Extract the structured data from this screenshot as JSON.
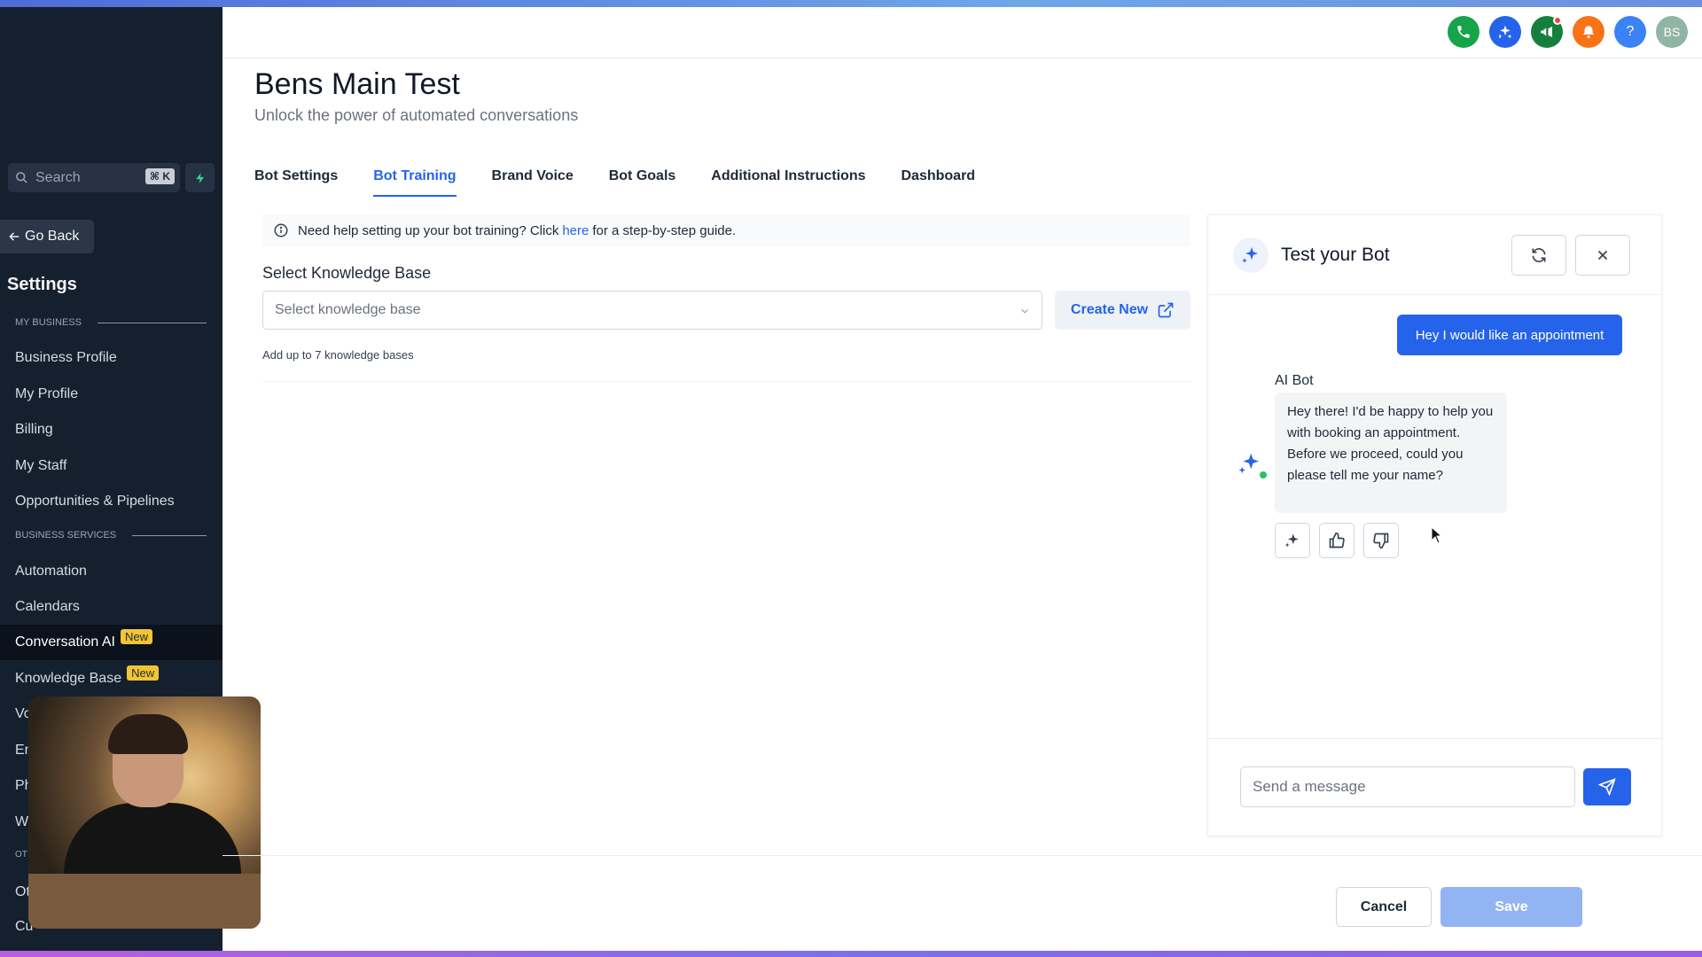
{
  "header": {
    "icons": [
      {
        "name": "phone-icon",
        "color": "#16a34a"
      },
      {
        "name": "ai-sparkle-icon",
        "color": "#2563eb"
      },
      {
        "name": "megaphone-icon",
        "color": "#15803d"
      },
      {
        "name": "bell-icon",
        "color": "#f97316"
      },
      {
        "name": "help-icon",
        "color": "#3b82f6",
        "glyph": "?"
      },
      {
        "name": "avatar",
        "color": "#8fb5a4",
        "glyph": "BS"
      }
    ]
  },
  "sidebar": {
    "search_placeholder": "Search",
    "search_shortcut": "⌘ K",
    "go_back": "Go Back",
    "title": "Settings",
    "section_my_business": "MY BUSINESS",
    "section_business_services": "BUSINESS SERVICES",
    "items": [
      {
        "label": "Business Profile"
      },
      {
        "label": "My Profile"
      },
      {
        "label": "Billing"
      },
      {
        "label": "My Staff"
      },
      {
        "label": "Opportunities & Pipelines"
      },
      {
        "label": "Automation"
      },
      {
        "label": "Calendars"
      },
      {
        "label": "Conversation AI",
        "badge": "New",
        "active": true
      },
      {
        "label": "Knowledge Base",
        "badge": "New"
      },
      {
        "label": "Vo"
      },
      {
        "label": "En"
      },
      {
        "label": "Ph"
      },
      {
        "label": "W"
      },
      {
        "label": "Ot"
      },
      {
        "label": "Cu"
      }
    ],
    "section_other_partial": "OT"
  },
  "main": {
    "title": "Bens Main Test",
    "subtitle": "Unlock the power of automated conversations",
    "tabs": [
      {
        "label": "Bot Settings"
      },
      {
        "label": "Bot Training",
        "active": true
      },
      {
        "label": "Brand Voice"
      },
      {
        "label": "Bot Goals"
      },
      {
        "label": "Additional Instructions"
      },
      {
        "label": "Dashboard"
      }
    ],
    "info_prefix": "Need help setting up your bot training? Click",
    "info_link": "here",
    "info_suffix": "for a step-by-step guide.",
    "kb_label": "Select Knowledge Base",
    "kb_placeholder": "Select knowledge base",
    "create_new": "Create New",
    "kb_hint": "Add up to 7 knowledge bases"
  },
  "test_panel": {
    "title": "Test your Bot",
    "user_message": "Hey I would like an appointment",
    "bot_name": "AI Bot",
    "bot_message": "Hey there! I'd be happy to help you with booking an appointment. Before we proceed, could you please tell me your name?",
    "input_placeholder": "Send a message"
  },
  "footer": {
    "cancel": "Cancel",
    "save": "Save"
  },
  "colors": {
    "primary": "#2563eb",
    "sidebar_bg": "#15202f",
    "badge": "#f3c433",
    "save_disabled": "#93b4f3"
  }
}
